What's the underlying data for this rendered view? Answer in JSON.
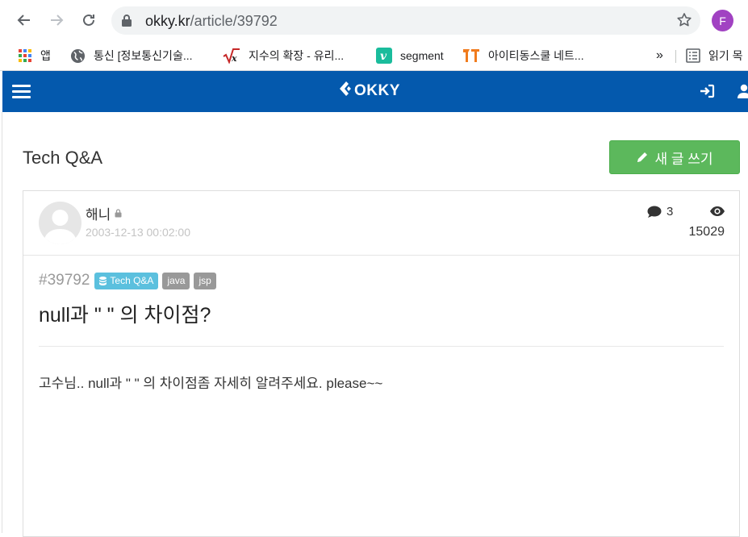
{
  "browser": {
    "url_domain": "okky.kr",
    "url_path": "/article/39792",
    "profile_initial": "F",
    "profile_color": "#a142c2"
  },
  "bookmarks": [
    {
      "label": "앱",
      "icon": "apps-grid-icon"
    },
    {
      "label": "통신 [정보통신기술...",
      "icon": "globe-icon"
    },
    {
      "label": "지수의 확장 - 유리...",
      "icon": "sqrt-x-icon"
    },
    {
      "label": "segment",
      "icon": "v-logo-icon"
    },
    {
      "label": "아이티동스쿨 네트...",
      "icon": "it-logo-icon"
    },
    {
      "label": "»",
      "icon": "overflow-chevron"
    },
    {
      "label": "읽기 목",
      "icon": "reading-list-icon"
    }
  ],
  "site": {
    "logo_text": "OKKY",
    "header_color": "#0459ad"
  },
  "page": {
    "section_title": "Tech Q&A",
    "write_button": "새 글 쓰기",
    "write_button_color": "#5cb85c"
  },
  "post": {
    "author": "해니",
    "date": "2003-12-13 00:02:00",
    "comment_count": "3",
    "view_count": "15029",
    "id": "#39792",
    "category": "Tech Q&A",
    "tags": [
      "java",
      "jsp"
    ],
    "title": "null과 \" \" 의 차이점?",
    "body": "고수님.. null과 \" \" 의 차이점좀 자세히 알려주세요. please~~"
  }
}
